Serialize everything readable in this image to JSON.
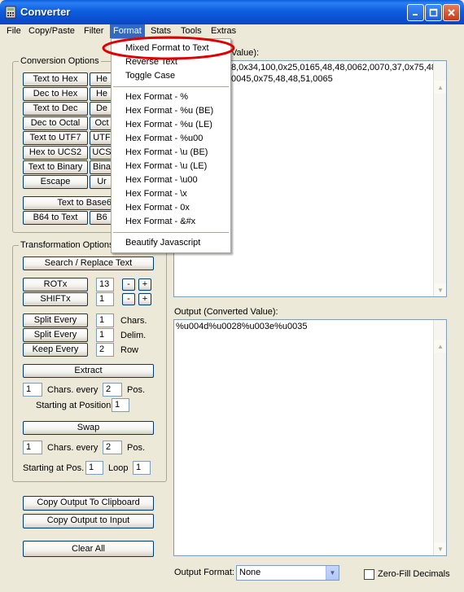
{
  "window": {
    "title": "Converter",
    "icon": "calculator-icon"
  },
  "menu": [
    "File",
    "Copy/Paste",
    "Filter",
    "Format",
    "Stats",
    "Tools",
    "Extras"
  ],
  "format_menu": {
    "items": [
      "Mixed Format to Text",
      "Reverse Text",
      "Toggle Case",
      "Hex Format - %",
      "Hex Format - %u (BE)",
      "Hex Format - %u (LE)",
      "Hex Format - %u00",
      "Hex Format - \\u (BE)",
      "Hex Format - \\u (LE)",
      "Hex Format - \\u00",
      "Hex Format - \\x",
      "Hex Format - 0x",
      "Hex Format - &#x",
      "Beautify Javascript"
    ],
    "highlight_color": "#e00000"
  },
  "conversion": {
    "label": "Conversion Options",
    "left": [
      "Text to Hex",
      "Dec to Hex",
      "Text to Dec",
      "Dec to Octal",
      "Text to UTF7",
      "Hex to UCS2",
      "Text to Binary",
      "Escape"
    ],
    "right": [
      "He",
      "He",
      "De",
      "Oct",
      "UTF",
      "UCS",
      "Bina",
      "Ur"
    ],
    "b64_full": "Text to Base6",
    "b64_left": "B64 to Text",
    "b64_right": "B6"
  },
  "transform": {
    "label": "Transformation Options",
    "search_replace": "Search / Replace Text",
    "rotx": "ROTx",
    "rotx_value": "13",
    "shiftx": "SHIFTx",
    "shiftx_value": "1",
    "minus": "-",
    "plus": "+",
    "split_every": "Split Every",
    "split_value": "1",
    "split_unit": "Chars.",
    "split_delim": "Split Every",
    "delim_value": "1",
    "delim_unit": "Delim.",
    "keep_every": "Keep Every",
    "keep_value": "2",
    "keep_unit": "Row",
    "extract": "Extract",
    "extract_chars": "1",
    "chars_every_text": "Chars. every",
    "extract_pos": "2",
    "pos_text": "Pos.",
    "starting_at_position": "Starting at Position",
    "start_value": "1",
    "swap": "Swap",
    "swap_chars": "1",
    "swap_chars_every": "Chars. every",
    "swap_pos": "2",
    "swap_pos_text": "Pos.",
    "starting_at_pos": "Starting at Pos.",
    "swap_start": "1",
    "loop": "Loop",
    "loop_value": "1"
  },
  "actions": {
    "copy_clipboard": "Copy Output To Clipboard",
    "copy_input": "Copy Output to Input",
    "clear_all": "Clear All"
  },
  "input": {
    "label_visible": "Value):",
    "line1": "8,0x34,100,0x25,0165,48,48,0062,0070,37,0x75,48",
    "line2": "0045,0x75,48,48,51,0065"
  },
  "output": {
    "label": "Output (Converted Value):",
    "value": "%u004d%u0028%u003e%u0035"
  },
  "footer": {
    "output_format_label": "Output Format:",
    "output_format_value": "None",
    "zero_fill": "Zero-Fill Decimals"
  }
}
